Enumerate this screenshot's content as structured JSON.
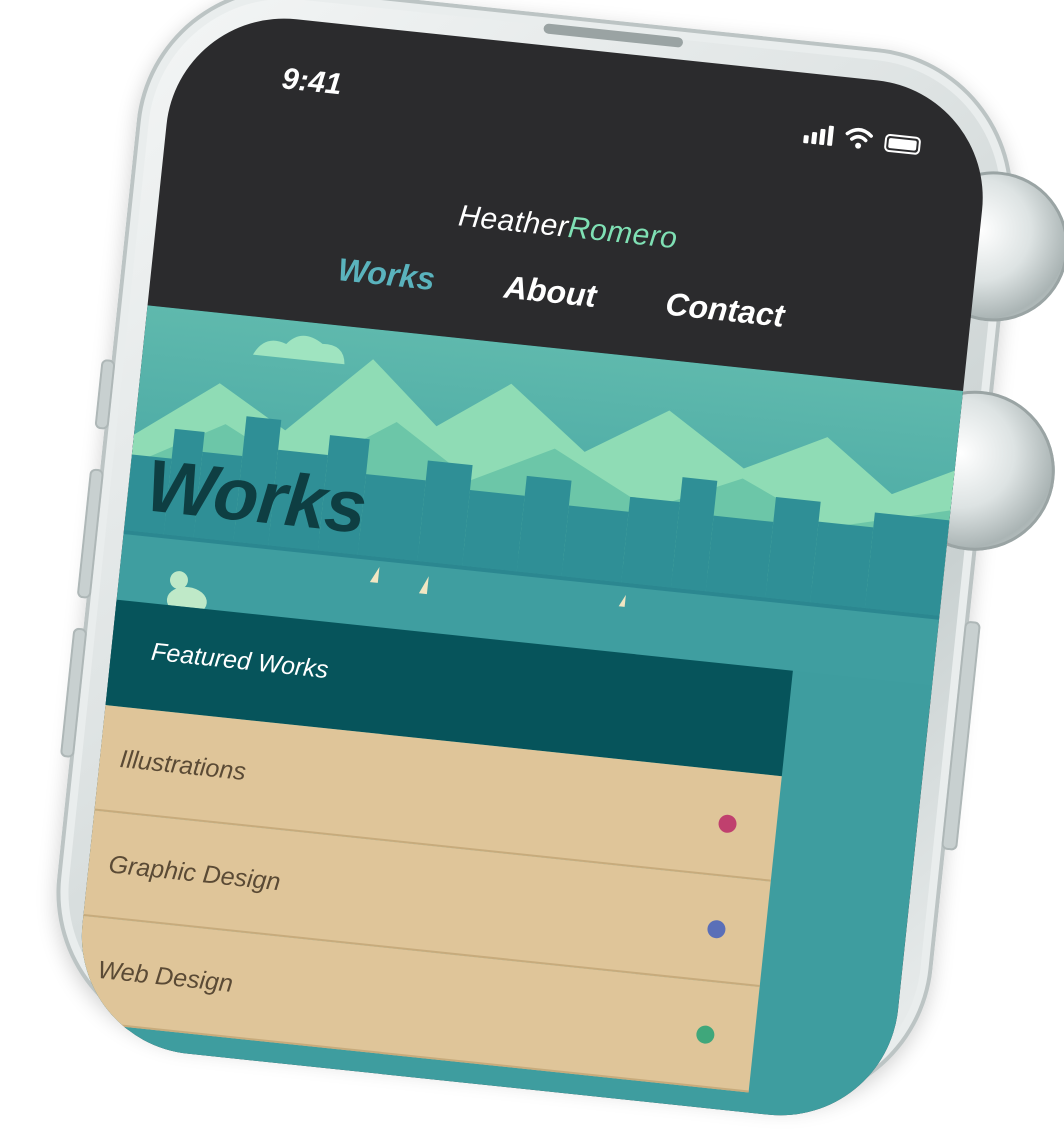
{
  "status_bar": {
    "time": "9:41"
  },
  "header": {
    "brand_first": "Heather",
    "brand_last": "Romero",
    "nav": [
      {
        "label": "Works",
        "active": true
      },
      {
        "label": "About",
        "active": false
      },
      {
        "label": "Contact",
        "active": false
      }
    ]
  },
  "hero": {
    "title": "Works"
  },
  "list": {
    "heading": "Featured Works",
    "items": [
      {
        "label": "Illustrations",
        "dot_color": "#c0406e"
      },
      {
        "label": "Graphic Design",
        "dot_color": "#5a6fb8"
      },
      {
        "label": "Web Design",
        "dot_color": "#3fa77b"
      }
    ]
  },
  "colors": {
    "brand_accent": "#7fe0b4",
    "nav_active": "#5ab3bd",
    "header_bg": "#2b2b2d",
    "featured_bg": "#06545b",
    "list_bg": "#dfc599"
  }
}
